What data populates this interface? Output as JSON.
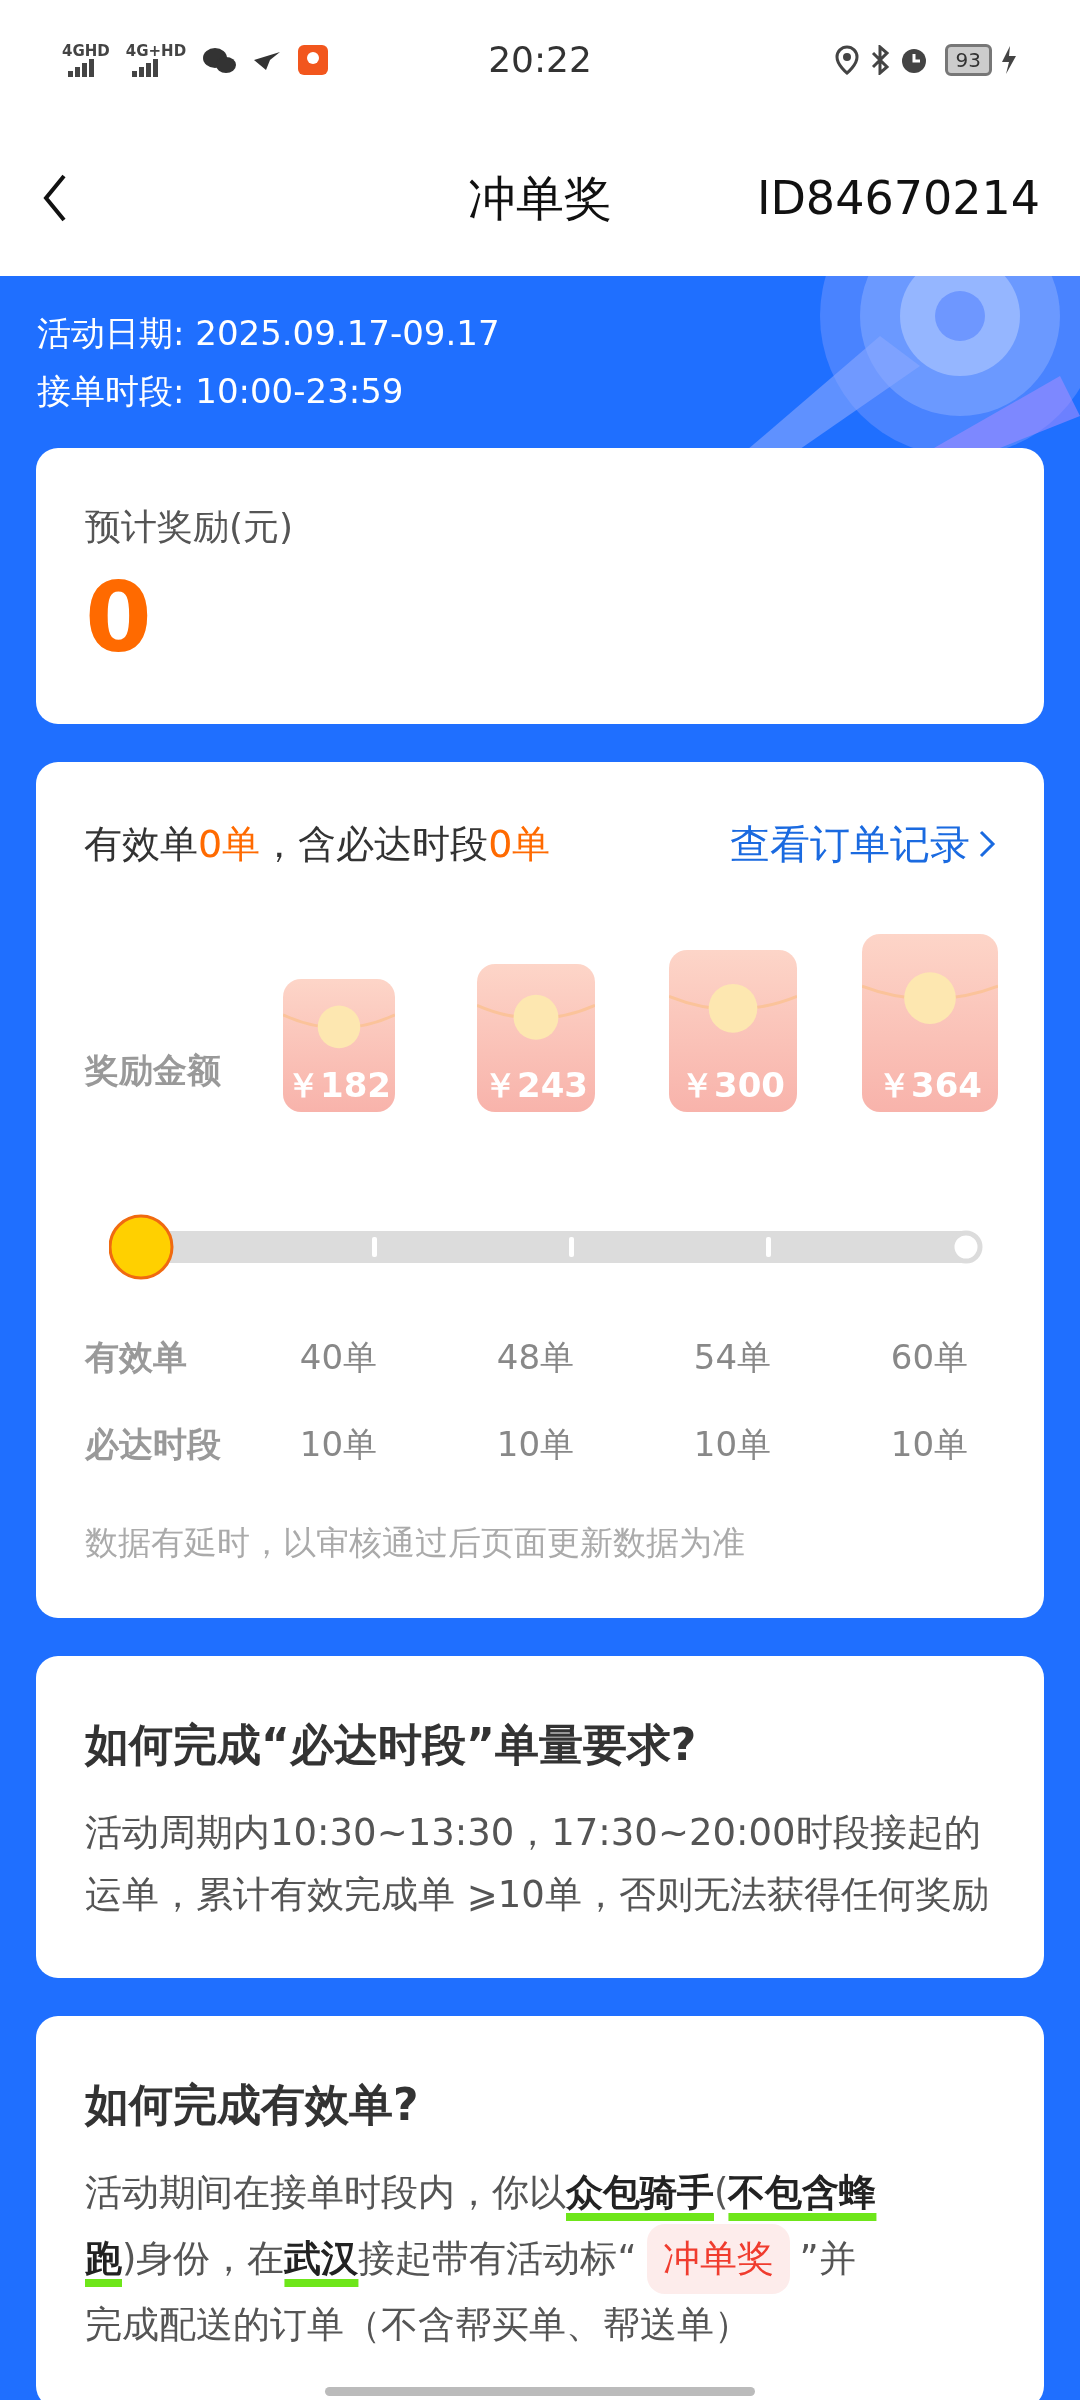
{
  "status_bar": {
    "network_1": "4GHD",
    "network_2": "4G+HD",
    "time": "20:22",
    "battery": "93"
  },
  "header": {
    "title": "冲单奖",
    "id": "ID84670214"
  },
  "banner": {
    "date_label": "活动日期: 2025.09.17-09.17",
    "hours_label": "接单时段: 10:00-23:59"
  },
  "reward_card": {
    "label": "预计奖励(元)",
    "amount": "0"
  },
  "progress_card": {
    "summary": [
      {
        "text": "有效单",
        "kind": "plain"
      },
      {
        "text": "0单",
        "kind": "highlight"
      },
      {
        "text": "，含必达时段",
        "kind": "plain"
      },
      {
        "text": "0单",
        "kind": "highlight"
      }
    ],
    "link": "查看订单记录",
    "amount_label": "奖励金额",
    "valid_label": "有效单",
    "must_label": "必达时段",
    "progress": {
      "level": 0
    },
    "tiers": [
      {
        "amount": "￥182",
        "valid": "40单",
        "must": "10单"
      },
      {
        "amount": "￥243",
        "valid": "48单",
        "must": "10单"
      },
      {
        "amount": "￥300",
        "valid": "54单",
        "must": "10单"
      },
      {
        "amount": "￥364",
        "valid": "60单",
        "must": "10单"
      }
    ],
    "note": "数据有延时，以审核通过后页面更新数据为准"
  },
  "rules": [
    {
      "title": "如何完成“必达时段”单量要求?",
      "segments": [
        {
          "kind": "text",
          "text": "活动周期内10:30~13:30，17:30~20:00时段接起的运单，累计有效完成单 ⩾10单，否则无法获得任何奖励"
        }
      ]
    },
    {
      "title": "如何完成有效单?",
      "lines": [
        [
          {
            "kind": "text",
            "text": "活动期间在接单时段内，你以**众包骑手**(**不包含蜂**"
          }
        ],
        [
          {
            "kind": "text",
            "text": "**跑**)身份，在**武汉**接起带有活动标“"
          },
          {
            "kind": "tag",
            "text": "冲单奖"
          },
          {
            "kind": "text",
            "text": "”并"
          }
        ],
        [
          {
            "kind": "text",
            "text": "完成配送的订单（不含帮买单、帮送单）"
          }
        ]
      ]
    }
  ]
}
